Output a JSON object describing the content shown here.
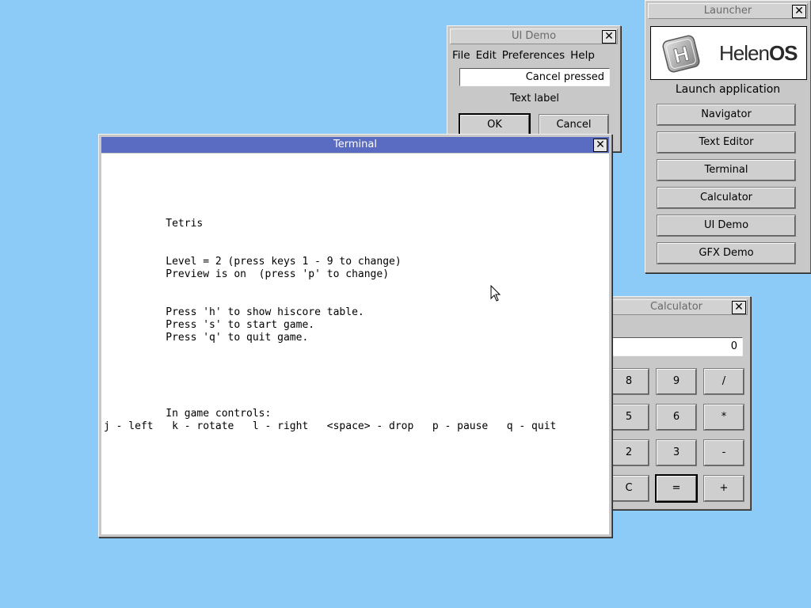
{
  "launcher": {
    "title": "Launcher",
    "logo_text_regular": "Helen",
    "logo_text_bold": "OS",
    "logo_letter": "H",
    "heading": "Launch application",
    "buttons": [
      "Navigator",
      "Text Editor",
      "Terminal",
      "Calculator",
      "UI Demo",
      "GFX Demo"
    ]
  },
  "uidemo": {
    "title": "UI Demo",
    "menu": [
      "File",
      "Edit",
      "Preferences",
      "Help"
    ],
    "entry_value": "Cancel pressed",
    "text_label": "Text label",
    "ok_label": "OK",
    "cancel_label": "Cancel"
  },
  "calculator": {
    "title": "Calculator",
    "display": "0",
    "keys": [
      [
        "8",
        "9",
        "/"
      ],
      [
        "5",
        "6",
        "*"
      ],
      [
        "2",
        "3",
        "-"
      ],
      [
        "C",
        "=",
        "+"
      ]
    ]
  },
  "terminal": {
    "title": "Terminal",
    "lines": [
      "          Tetris",
      "          Level = 2 (press keys 1 - 9 to change)",
      "          Preview is on  (press 'p' to change)",
      "          Press 'h' to show hiscore table.",
      "          Press 's' to start game.",
      "          Press 'q' to quit game.",
      "          In game controls:",
      "j - left   k - rotate   l - right   <space> - drop   p - pause   q - quit"
    ]
  },
  "colors": {
    "desktop": "#8ccaf8",
    "active_title": "#5a6bc2",
    "window": "#c8c8c8"
  },
  "icons": {
    "close": "close-icon",
    "cursor": "mouse-pointer-icon"
  }
}
